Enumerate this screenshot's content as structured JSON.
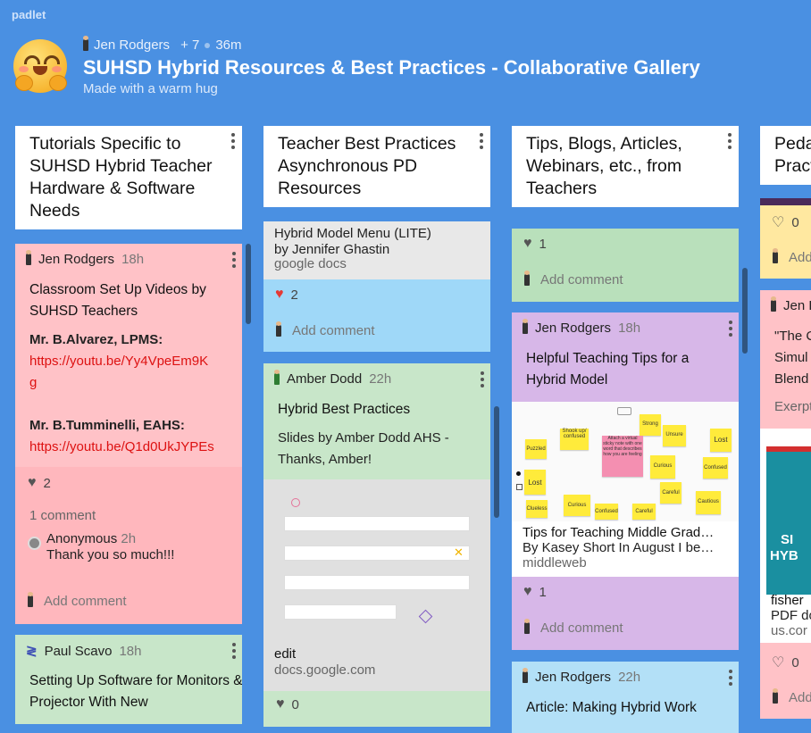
{
  "app": {
    "logo": "padlet"
  },
  "board": {
    "author": "Jen Rodgers",
    "contributors": "+ 7",
    "age": "36m",
    "title": "SUHSD Hybrid Resources & Best Practices - Collaborative Gallery",
    "subtitle": "Made with a warm hug"
  },
  "columns": [
    {
      "title": "Tutorials Specific to SUHSD Hybrid Teacher Hardware & Software Needs"
    },
    {
      "title": "Teacher Best Practices Asynchronous PD Resources"
    },
    {
      "title": "Tips, Blogs, Articles, Webinars, etc., from Teachers"
    },
    {
      "title": "Pedagogy Practices"
    }
  ],
  "col1": {
    "post1": {
      "author": "Jen Rodgers",
      "time": "18h",
      "title": "Classroom Set Up Videos by SUHSD Teachers",
      "name1": "Mr. B.Alvarez, LPMS:",
      "link1a": "https://youtu.be/Yy4VpeEm9K",
      "link1b": "g",
      "name2": "Mr. B.Tumminelli, EAHS:",
      "link2": "https://youtu.be/Q1d0UkJYPEs",
      "likes": "2",
      "comments_count": "1 comment",
      "comment_author": "Anonymous",
      "comment_time": "2h",
      "comment_text": "Thank you so much!!!",
      "add_comment": "Add comment"
    },
    "post2": {
      "author": "Paul Scavo",
      "time": "18h",
      "title": "Setting Up Software for Monitors & Projector With New"
    }
  },
  "col2": {
    "post1": {
      "attach_title": "Hybrid Model Menu (LITE)",
      "attach_sub": "by Jennifer Ghastin",
      "attach_source": "google docs",
      "likes": "2",
      "add_comment": "Add comment"
    },
    "post2": {
      "author": "Amber Dodd",
      "time": "22h",
      "title": "Hybrid Best Practices",
      "body": "Slides by Amber Dodd AHS - Thanks, Amber!",
      "attach_title": "edit",
      "attach_source": "docs.google.com"
    },
    "post3": {
      "likes": "0"
    }
  },
  "col3": {
    "post1": {
      "likes": "1",
      "add_comment": "Add comment"
    },
    "post2": {
      "author": "Jen Rodgers",
      "time": "18h",
      "title": "Helpful Teaching Tips for a Hybrid Model",
      "attach_title": "Tips for Teaching Middle Grad…",
      "attach_sub": "By Kasey Short In August I be…",
      "attach_source": "middleweb",
      "likes": "1",
      "add_comment": "Add comment",
      "notes": [
        "Shook up/ confused",
        "Strong",
        "Unsure",
        "Lost",
        "Puzzled",
        "Lost",
        "Curious",
        "Confused",
        "Curious",
        "Careful",
        "Cautious",
        "Confused",
        "Careful",
        "Clueless",
        "Attach a virtual sticky note with one word that describes how you are feeling"
      ]
    },
    "post3": {
      "author": "Jen Rodgers",
      "time": "22h",
      "title": "Article: Making Hybrid Work"
    }
  },
  "col4": {
    "post1": {
      "likes": "0",
      "add_comment": "Add comment"
    },
    "post2": {
      "author": "Jen Rodgers",
      "title_l1": "\"The C",
      "title_l2": "Simul",
      "title_l3": "Blend",
      "excerpt": "Exerpt",
      "book_a": "SI",
      "book_b": "HYB",
      "attach_title": "fisher",
      "attach_sub": "PDF do",
      "attach_source": "us.cor",
      "likes": "0",
      "add_comment": "Add"
    }
  },
  "colors": {
    "background": "#4a90e2",
    "pink": "#ffc2c7",
    "green": "#c8e6c9",
    "blue": "#9fd8f8",
    "purple": "#d7b7e8",
    "yellow": "#ffe8a0",
    "link": "#d11111"
  }
}
